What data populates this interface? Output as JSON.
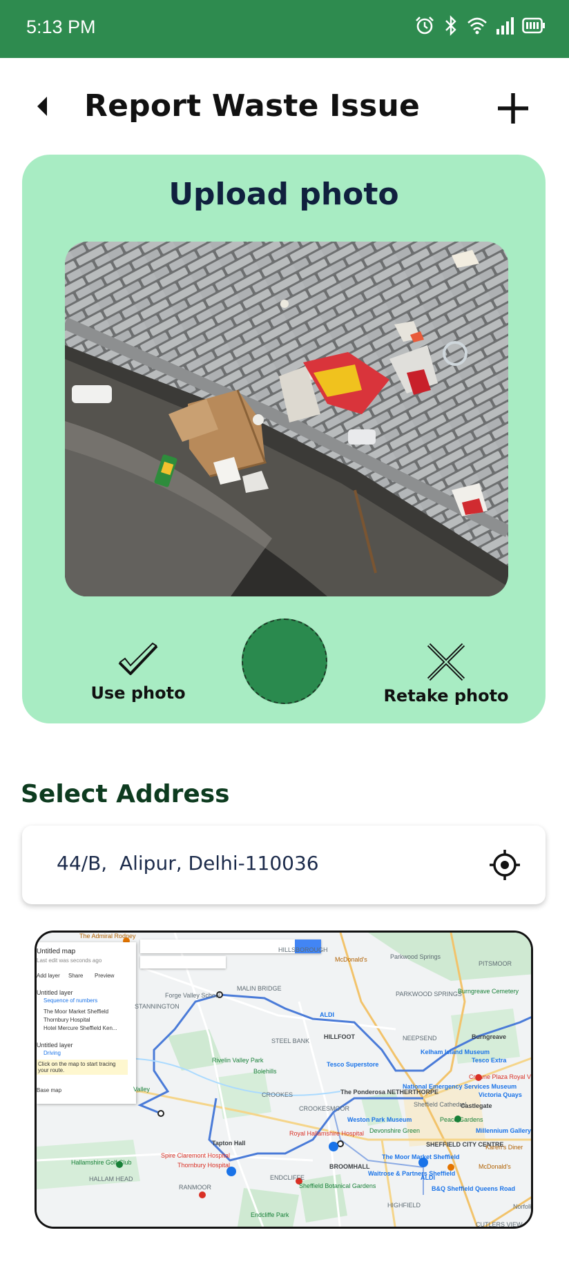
{
  "status_bar": {
    "time": "5:13 PM",
    "icons": [
      "alarm-icon",
      "bluetooth-icon",
      "wifi-icon",
      "signal-icon",
      "battery-icon"
    ]
  },
  "header": {
    "title": "Report Waste Issue",
    "back_icon": "back-triangle-icon",
    "add_icon": "plus-icon"
  },
  "upload": {
    "title": "Upload photo",
    "use_label": "Use photo",
    "retake_label": "Retake photo"
  },
  "address": {
    "label": "Select Address",
    "value": "44/B,  Alipur, Delhi-110036",
    "locate_icon": "locate-target-icon"
  },
  "map": {
    "panel": {
      "title": "Untitled map",
      "subtitle": "Last edit was seconds ago",
      "add_layer": "Add layer",
      "share": "Share",
      "preview": "Preview",
      "layer1": "Untitled layer",
      "sequence": "Sequence of numbers",
      "stop1": "The Moor Market Sheffield",
      "stop2": "Thornbury Hospital",
      "stop3": "Hotel Mercure Sheffield Ken...",
      "layer2": "Untitled layer",
      "driving": "Driving",
      "hint": "Click on the map to start tracing your route.",
      "base_map": "Base map"
    },
    "labels": {
      "admiral": "The Admiral Rodney",
      "mcdonalds1": "McDonald's",
      "parkwood": "Parkwood Springs",
      "pitsmoor": "PITSMOOR",
      "hillsborough": "HILLSBOROUGH",
      "forge": "Forge Valley School",
      "malin": "MALIN BRIDGE",
      "parkwood_springs": "PARKWOOD SPRINGS",
      "burngreave_cem": "Burngreave Cemetery",
      "stannington": "STANNINGTON",
      "aldi1": "ALDI",
      "neepsend": "NEEPSEND",
      "burngreave": "Burngreave",
      "steel_bank": "STEEL BANK",
      "hillfoot": "HILLFOOT",
      "kelham": "Kelham Island Museum",
      "tesco_extra": "Tesco Extra",
      "rivelin": "Rivelin Valley Park",
      "tesco_superstore": "Tesco Superstore",
      "bolehills": "Bolehills",
      "crowne": "Crowne Plaza Royal Victoria",
      "valley": "Valley",
      "crookes": "CROOKES",
      "ponderosa": "The Ponderosa NETHERTHORPE",
      "nat_emergency": "National Emergency Services Museum",
      "victoria_quays": "Victoria Quays",
      "crookesmoor": "CROOKESMOOR",
      "sheffield_cathedral": "Sheffield Cathedral",
      "castlegate": "Castlegate",
      "weston": "Weston Park Museum",
      "peace": "Peace Gardens",
      "millennium": "Millennium Gallery",
      "royal_hallamshire": "Royal Hallamshire Hospital",
      "devonshire": "Devonshire Green",
      "sheffield_city": "SHEFFIELD CITY CENTRE",
      "tapton": "Tapton Hall",
      "spire": "Spire Claremont Hospital",
      "moor_market": "The Moor Market Sheffield",
      "karens": "Karen's Diner",
      "hallamshire_golf": "Hallamshire Golf Club",
      "thornbury": "Thornbury Hospital",
      "broomhall": "BROOMHALL",
      "mcdonalds2": "McDonald's",
      "hallam_head": "HALLAM HEAD",
      "ranmoor": "RANMOOR",
      "endcliffe": "ENDCLIFFE",
      "waitrose": "Waitrose & Partners Sheffield",
      "aldi2": "ALDI",
      "botanical": "Sheffield Botanical Gardens",
      "bq": "B&Q Sheffield Queens Road",
      "highfield": "HIGHFIELD",
      "endcliffe_park": "Endcliffe Park",
      "cutlers": "CUTLERS VIEW",
      "norfolk": "Norfolk Heritage"
    }
  },
  "colors": {
    "status_bar": "#2e8b4f",
    "card_bg": "#a8ecc3",
    "shutter": "#2a8a4e",
    "upload_title": "#10203e",
    "address_label": "#0d3b1f"
  }
}
